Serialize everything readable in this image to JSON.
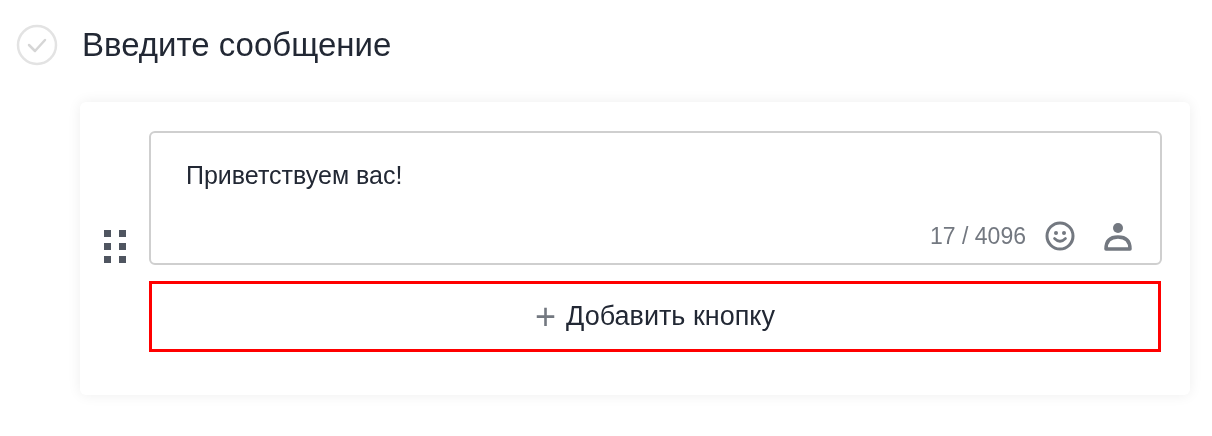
{
  "step": {
    "title": "Введите сообщение"
  },
  "message": {
    "value": "Приветствуем вас!",
    "counter": "17 / 4096"
  },
  "add_button": {
    "icon": "+",
    "label": "Добавить кнопку"
  }
}
